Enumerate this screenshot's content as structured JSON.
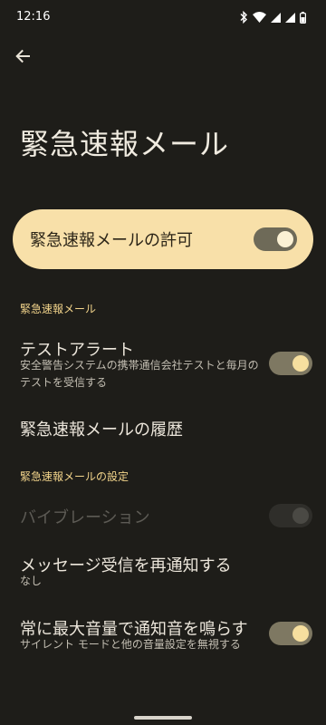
{
  "status_bar": {
    "time": "12:16",
    "icons": [
      "bluetooth-icon",
      "wifi-icon",
      "signal-icon",
      "signal-icon",
      "battery-icon"
    ]
  },
  "header": {
    "back_icon": "arrow-left-icon",
    "title": "緊急速報メール"
  },
  "master_toggle": {
    "label": "緊急速報メールの許可",
    "on": true
  },
  "sections": [
    {
      "header": "緊急速報メール",
      "items": [
        {
          "title": "テストアラート",
          "summary": "安全警告システムの携帯通信会社テストと毎月のテストを受信する",
          "toggle": true
        },
        {
          "title": "緊急速報メールの履歴"
        }
      ]
    },
    {
      "header": "緊急速報メールの設定",
      "items": [
        {
          "title": "バイブレーション",
          "toggle": true,
          "enabled": false
        },
        {
          "title": "メッセージ受信を再通知する",
          "summary": "なし"
        },
        {
          "title": "常に最大音量で通知音を鳴らす",
          "summary": "サイレント モードと他の音量設定を無視する",
          "toggle": true
        }
      ]
    }
  ],
  "colors": {
    "background": "#1e1d19",
    "accent_card": "#f8e0a9",
    "section_header": "#f2d48b",
    "switch_thumb": "#f6df9f",
    "switch_track": "#7e7862"
  }
}
